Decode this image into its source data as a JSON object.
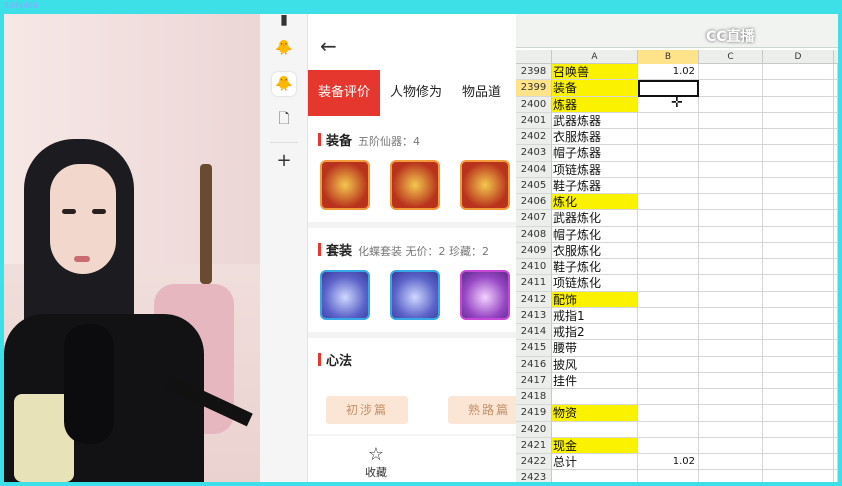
{
  "app": {
    "capture_label": "834x468"
  },
  "excel": {
    "logo": "CC直播",
    "columns": [
      "A",
      "B",
      "C",
      "D"
    ],
    "rows": [
      {
        "n": "2398",
        "a": "召唤兽",
        "b": "1.02",
        "hl": true
      },
      {
        "n": "2399",
        "a": "装备",
        "b": "",
        "hl": true,
        "active": true
      },
      {
        "n": "2400",
        "a": "炼器",
        "b": "",
        "hl": true
      },
      {
        "n": "2401",
        "a": "武器炼器",
        "b": ""
      },
      {
        "n": "2402",
        "a": "衣服炼器",
        "b": ""
      },
      {
        "n": "2403",
        "a": "帽子炼器",
        "b": ""
      },
      {
        "n": "2404",
        "a": "项链炼器",
        "b": ""
      },
      {
        "n": "2405",
        "a": "鞋子炼器",
        "b": ""
      },
      {
        "n": "2406",
        "a": "炼化",
        "b": "",
        "hl": true
      },
      {
        "n": "2407",
        "a": "武器炼化",
        "b": ""
      },
      {
        "n": "2408",
        "a": "帽子炼化",
        "b": ""
      },
      {
        "n": "2409",
        "a": "衣服炼化",
        "b": ""
      },
      {
        "n": "2410",
        "a": "鞋子炼化",
        "b": ""
      },
      {
        "n": "2411",
        "a": "项链炼化",
        "b": ""
      },
      {
        "n": "2412",
        "a": "配饰",
        "b": "",
        "hl": true
      },
      {
        "n": "2413",
        "a": "戒指1",
        "b": ""
      },
      {
        "n": "2414",
        "a": "戒指2",
        "b": ""
      },
      {
        "n": "2415",
        "a": "腰带",
        "b": ""
      },
      {
        "n": "2416",
        "a": "披风",
        "b": ""
      },
      {
        "n": "2417",
        "a": "挂件",
        "b": ""
      },
      {
        "n": "2418",
        "a": "",
        "b": ""
      },
      {
        "n": "2419",
        "a": "物资",
        "b": "",
        "hl": true
      },
      {
        "n": "2420",
        "a": "",
        "b": ""
      },
      {
        "n": "2421",
        "a": "现金",
        "b": "",
        "hl": true
      },
      {
        "n": "2422",
        "a": "总计",
        "b": "1.02"
      },
      {
        "n": "2423",
        "a": "",
        "b": ""
      }
    ]
  },
  "panel": {
    "tabs": [
      "装备评价",
      "人物修为",
      "物品道"
    ],
    "sections": {
      "equip": {
        "title": "装备",
        "sub": "五阶仙器：4"
      },
      "set": {
        "title": "套装",
        "sub": "化蝶套装  无价：2  珍藏：2"
      },
      "xinfa": {
        "title": "心法"
      }
    },
    "xinfa_buttons": [
      "初涉篇",
      "熟路篇"
    ],
    "favorite_label": "收藏"
  }
}
